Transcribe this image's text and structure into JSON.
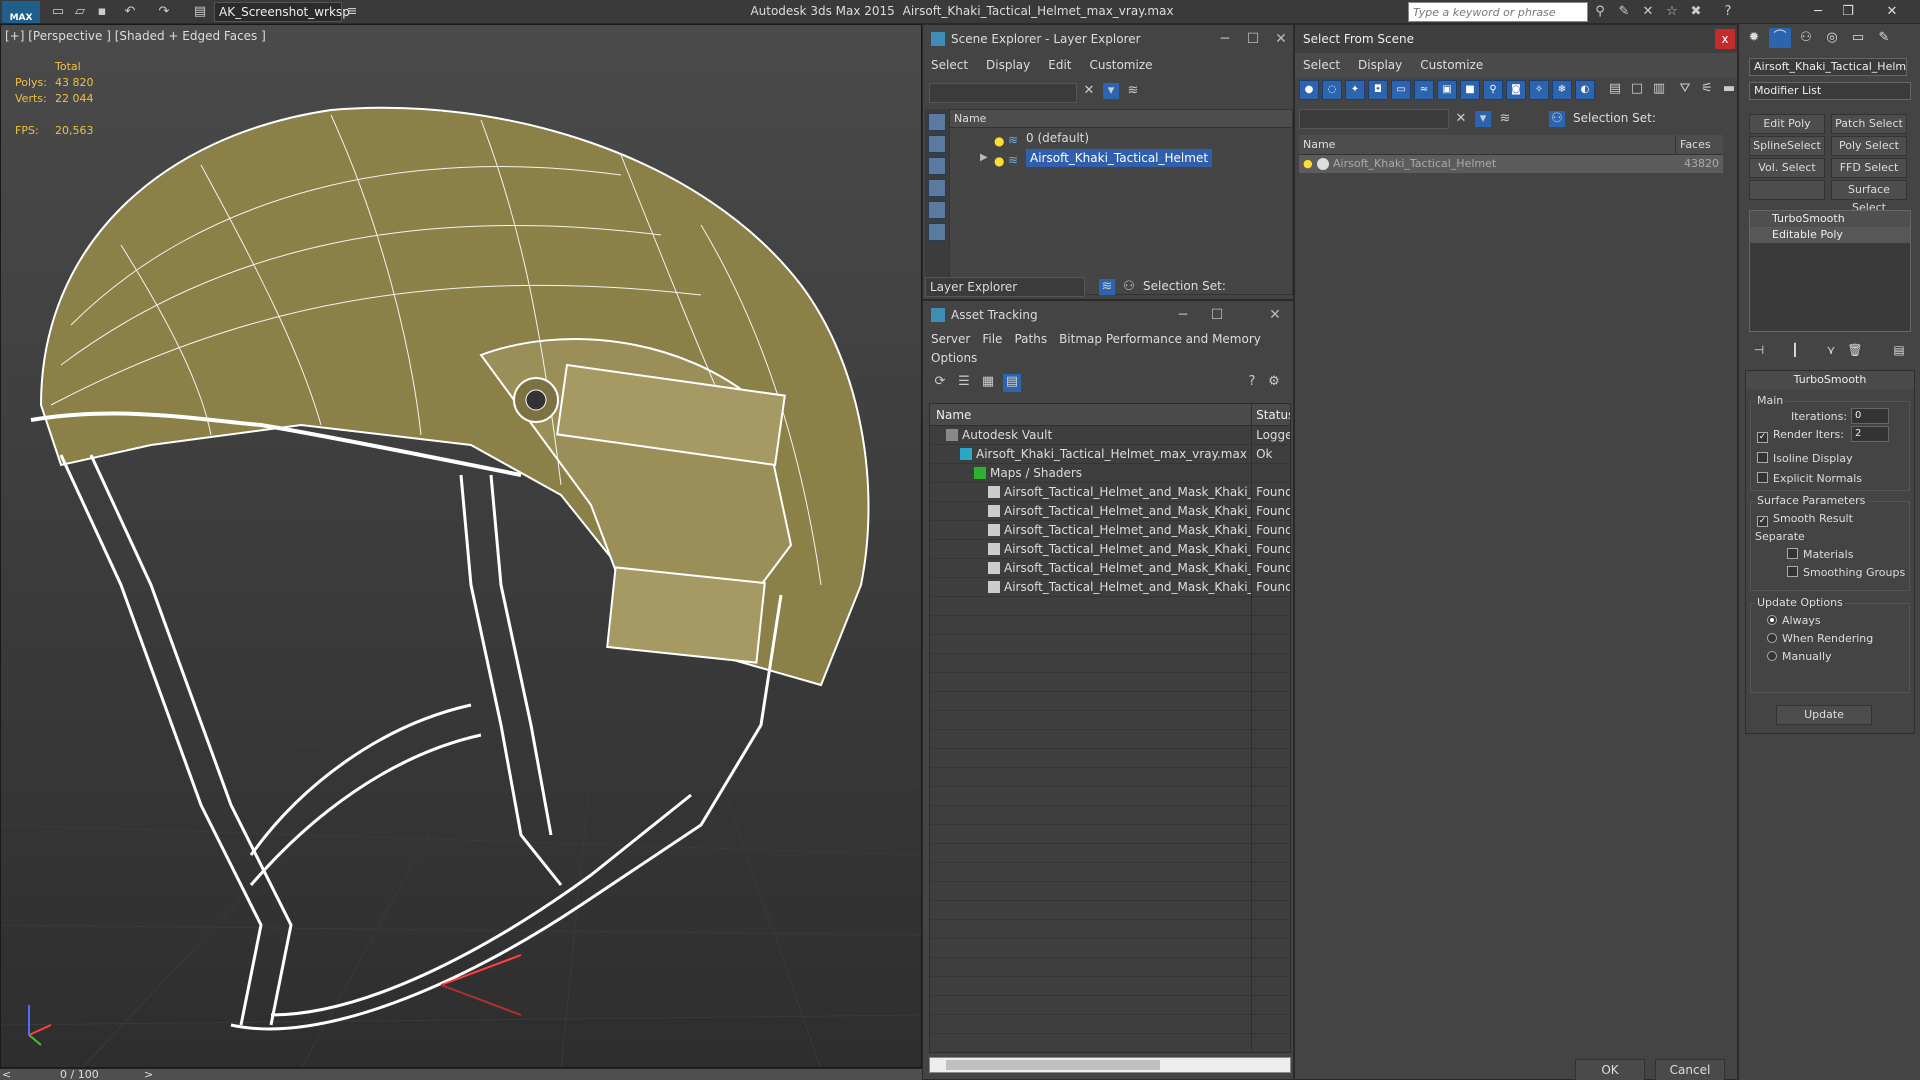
{
  "titlebar": {
    "logo": "MAX",
    "workspace": "AK_Screenshot_wrksp",
    "app_name": "Autodesk 3ds Max  2015",
    "file_name": "Airsoft_Khaki_Tactical_Helmet_max_vray.max",
    "search_placeholder": "Type a keyword or phrase"
  },
  "viewport": {
    "label": "[+] [Perspective ] [Shaded + Edged Faces ]",
    "stats": {
      "total_label": "Total",
      "polys_label": "Polys:",
      "polys_value": "43 820",
      "verts_label": "Verts:",
      "verts_value": "22 044",
      "fps_label": "FPS:",
      "fps_value": "20,563"
    },
    "colors": {
      "helmet": "#8a8048",
      "wire": "#ffffff"
    }
  },
  "timeline": {
    "frame": "0 / 100",
    "prev": "<",
    "next": ">"
  },
  "scene_explorer": {
    "title": "Scene Explorer - Layer Explorer",
    "menu": [
      "Select",
      "Display",
      "Edit",
      "Customize"
    ],
    "column_name": "Name",
    "rows": [
      {
        "label": "0 (default)",
        "selected": false
      },
      {
        "label": "Airsoft_Khaki_Tactical_Helmet",
        "selected": true
      }
    ],
    "explorer_dropdown": "Layer Explorer",
    "selection_set_label": "Selection Set:"
  },
  "asset_tracking": {
    "title": "Asset Tracking",
    "menu": [
      "Server",
      "File",
      "Paths",
      "Bitmap Performance and Memory"
    ],
    "menu2": [
      "Options"
    ],
    "col_name": "Name",
    "col_status": "Status",
    "rows": [
      {
        "name": "Autodesk Vault",
        "status": "Logged",
        "indent": 0
      },
      {
        "name": "Airsoft_Khaki_Tactical_Helmet_max_vray.max",
        "status": "Ok",
        "indent": 1
      },
      {
        "name": "Maps / Shaders",
        "status": "",
        "indent": 2
      },
      {
        "name": "Airsoft_Tactical_Helmet_and_Mask_Khaki_...",
        "status": "Found",
        "indent": 3
      },
      {
        "name": "Airsoft_Tactical_Helmet_and_Mask_Khaki_...",
        "status": "Found",
        "indent": 3
      },
      {
        "name": "Airsoft_Tactical_Helmet_and_Mask_Khaki_...",
        "status": "Found",
        "indent": 3
      },
      {
        "name": "Airsoft_Tactical_Helmet_and_Mask_Khaki_...",
        "status": "Found",
        "indent": 3
      },
      {
        "name": "Airsoft_Tactical_Helmet_and_Mask_Khaki_...",
        "status": "Found",
        "indent": 3
      },
      {
        "name": "Airsoft_Tactical_Helmet_and_Mask_Khaki_...",
        "status": "Found",
        "indent": 3
      }
    ]
  },
  "select_from_scene": {
    "title": "Select From Scene",
    "close": "x",
    "menu": [
      "Select",
      "Display",
      "Customize"
    ],
    "selection_set_label": "Selection Set:",
    "col_name": "Name",
    "col_faces": "Faces",
    "row": {
      "name": "Airsoft_Khaki_Tactical_Helmet",
      "faces": "43820"
    },
    "ok": "OK",
    "cancel": "Cancel"
  },
  "command_panel": {
    "object_name": "Airsoft_Khaki_Tactical_Helme",
    "modifier_list": "Modifier List",
    "buttons": [
      "Edit Poly",
      "Patch Select",
      "SplineSelect",
      "Poly Select",
      "Vol. Select",
      "FFD Select",
      "",
      "Surface Select"
    ],
    "stack": [
      "TurboSmooth",
      "Editable Poly"
    ],
    "turbosmooth": {
      "header": "TurboSmooth",
      "main": "Main",
      "iterations_label": "Iterations:",
      "iterations_value": "0",
      "render_iters_label": "Render Iters:",
      "render_iters_value": "2",
      "isoline": "Isoline Display",
      "explicit_normals": "Explicit Normals",
      "surface_params": "Surface Parameters",
      "smooth_result": "Smooth Result",
      "separate": "Separate",
      "materials": "Materials",
      "smoothing_groups": "Smoothing Groups",
      "update_options": "Update Options",
      "always": "Always",
      "when_rendering": "When Rendering",
      "manually": "Manually",
      "update": "Update"
    }
  }
}
